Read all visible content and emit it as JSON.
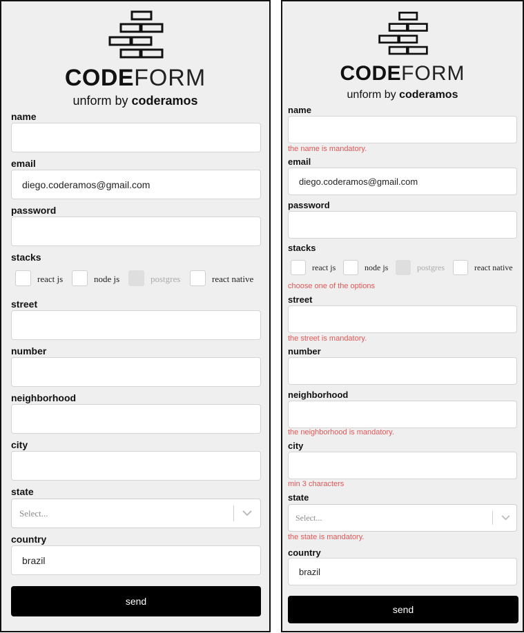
{
  "brand": {
    "bold": "CODE",
    "thin": "FORM",
    "subtitle_prefix": "unform by ",
    "subtitle_bold": "coderamos"
  },
  "icons": {
    "logo": "brick-wall-icon",
    "select_arrow": "chevron-down-icon"
  },
  "colors": {
    "error": "#e25656",
    "button": "#000000",
    "background": "#efefef"
  },
  "left": {
    "labels": {
      "name": "name",
      "email": "email",
      "password": "password",
      "stacks": "stacks",
      "street": "street",
      "number": "number",
      "neighborhood": "neighborhood",
      "city": "city",
      "state": "state",
      "country": "country"
    },
    "values": {
      "email": "diego.coderamos@gmail.com",
      "country": "brazil"
    },
    "stacks": [
      "react js",
      "node js",
      "postgres",
      "react native"
    ],
    "state_placeholder": "Select...",
    "send": "send"
  },
  "right": {
    "labels": {
      "name": "name",
      "email": "email",
      "password": "password",
      "stacks": "stacks",
      "street": "street",
      "number": "number",
      "neighborhood": "neighborhood",
      "city": "city",
      "state": "state",
      "country": "country"
    },
    "values": {
      "email": "diego.coderamos@gmail.com",
      "country": "brazil"
    },
    "stacks": [
      "react js",
      "node js",
      "postgres",
      "react native"
    ],
    "errors": {
      "name": "the name is mandatory.",
      "stacks": "choose one of the options",
      "street": "the street is mandatory.",
      "neighborhood": "the neighborhood is mandatory.",
      "city": "min 3 characters",
      "state": "the state is mandatory."
    },
    "state_placeholder": "Select...",
    "send": "send"
  }
}
